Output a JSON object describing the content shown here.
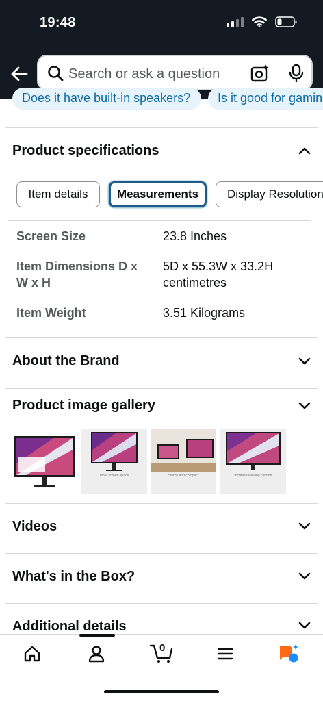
{
  "status_bar": {
    "time": "19:48"
  },
  "search": {
    "placeholder": "Search or ask a question"
  },
  "question_chips": [
    "Does it have built-in speakers?",
    "Is it good for gaming?"
  ],
  "sections": {
    "product_specifications": {
      "title": "Product specifications",
      "tabs": [
        "Item details",
        "Measurements",
        "Display Resolution"
      ],
      "active_tab": "Measurements",
      "rows": [
        {
          "label": "Screen Size",
          "value": "23.8 Inches"
        },
        {
          "label": "Item Dimensions D x W x H",
          "value": "5D x 55.3W x 33.2H centimetres"
        },
        {
          "label": "Item Weight",
          "value": "3.51 Kilograms"
        }
      ]
    },
    "about_brand": {
      "title": "About the Brand"
    },
    "image_gallery": {
      "title": "Product image gallery",
      "thumbnails": [
        {
          "caption": ""
        },
        {
          "caption": "More screen space"
        },
        {
          "caption": "Sturdy and compact"
        },
        {
          "caption": "Increase viewing comfort"
        }
      ]
    },
    "videos": {
      "title": "Videos"
    },
    "in_the_box": {
      "title": "What's in the Box?"
    },
    "additional_details": {
      "title": "Additional details"
    }
  },
  "bottom_nav": {
    "items": [
      "home-icon",
      "account-icon",
      "cart-icon",
      "menu-icon",
      "rufus-icon"
    ],
    "cart_count": "0"
  },
  "colors": {
    "header_bg": "#131a22",
    "chip_bg": "#e6f3fb",
    "chip_text": "#0b6aa3",
    "active_tab_border": "#1c5c86",
    "rufus_orange": "#ff6a13",
    "rufus_blue": "#1a8cff"
  }
}
